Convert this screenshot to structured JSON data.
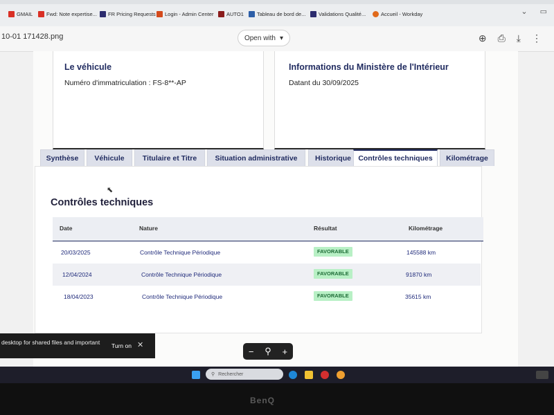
{
  "browser": {
    "bookmarks": [
      {
        "label": "GMAIL",
        "icon": "gmail-icon",
        "color": "#d93025"
      },
      {
        "label": "Fwd: Note expertise...",
        "icon": "gmail-icon",
        "color": "#d93025"
      },
      {
        "label": "FR Pricing Requests",
        "icon": "app-icon",
        "color": "#2c2c6e"
      },
      {
        "label": "Login - Admin Center",
        "icon": "app-icon",
        "color": "#d44a1c"
      },
      {
        "label": "AUTO1",
        "icon": "app-icon",
        "color": "#8a1c1c"
      },
      {
        "label": "Tableau de bord de...",
        "icon": "app-icon",
        "color": "#2d5fa8"
      },
      {
        "label": "Validations Qualité...",
        "icon": "app-icon",
        "color": "#2c2c6e"
      },
      {
        "label": "Accueil - Workday",
        "icon": "workday-icon",
        "color": "#e06a1b"
      }
    ]
  },
  "viewer": {
    "filename": "10-01 171428.png",
    "open_with": "Open with"
  },
  "document": {
    "vehicle_card": {
      "title": "Le véhicule",
      "plate_line": "Numéro d'immatriculation : FS-8**-AP"
    },
    "ministry_card": {
      "title": "Informations du Ministère de l'Intérieur",
      "date_line": "Datant du 30/09/2025"
    },
    "tabs": [
      {
        "label": "Synthèse"
      },
      {
        "label": "Véhicule"
      },
      {
        "label": "Titulaire et Titre"
      },
      {
        "label": "Situation administrative"
      },
      {
        "label": "Historique"
      },
      {
        "label": "Contrôles techniques"
      },
      {
        "label": "Kilométrage"
      }
    ],
    "section_title": "Contrôles techniques",
    "table": {
      "headers": [
        "Date",
        "Nature",
        "Résultat",
        "Kilométrage"
      ],
      "rows": [
        {
          "date": "20/03/2025",
          "nature": "Contrôle Technique Périodique",
          "result": "FAVORABLE",
          "km": "145588 km"
        },
        {
          "date": "12/04/2024",
          "nature": "Contrôle Technique Périodique",
          "result": "FAVORABLE",
          "km": "91870 km"
        },
        {
          "date": "18/04/2023",
          "nature": "Contrôle Technique Périodique",
          "result": "FAVORABLE",
          "km": "35615 km"
        }
      ]
    }
  },
  "notification": {
    "message": "desktop for shared files and important",
    "action": "Turn on"
  },
  "taskbar": {
    "search_placeholder": "Rechercher"
  },
  "monitor": {
    "brand": "BenQ"
  },
  "colors": {
    "accent_navy": "#1f2a5f",
    "badge_green": "#b8f0c5"
  }
}
